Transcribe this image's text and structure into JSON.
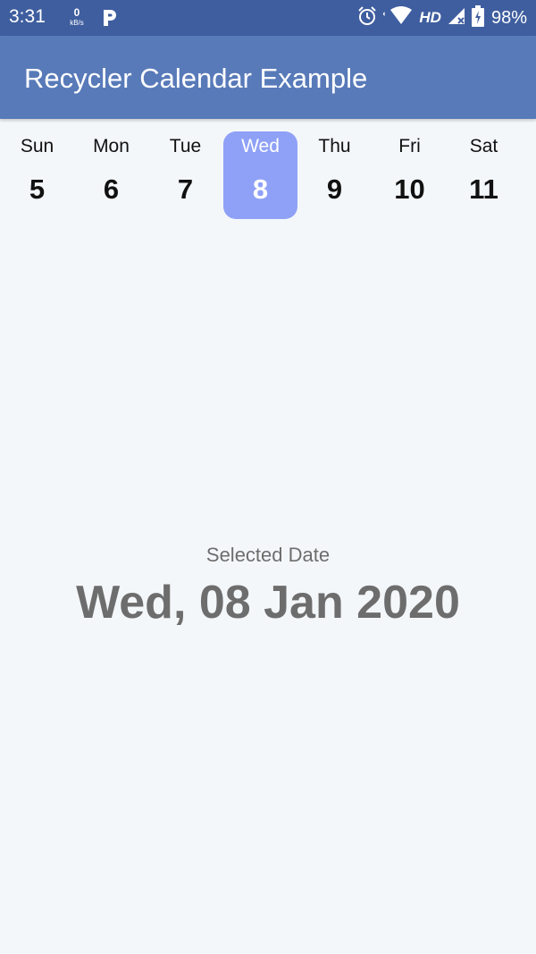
{
  "status_bar": {
    "time": "3:31",
    "net_speed_value": "0",
    "net_speed_unit": "kB/s",
    "hd_label": "HD",
    "battery_percent": "98%",
    "icons": [
      "parking-icon",
      "alarm-icon",
      "wifi-icon",
      "signal-icon",
      "battery-icon"
    ]
  },
  "app_bar": {
    "title": "Recycler Calendar Example",
    "color": "#587ab9"
  },
  "week": {
    "selected_index": 3,
    "selected_color": "#8fa1f7",
    "days": [
      {
        "name": "Sun",
        "number": "5"
      },
      {
        "name": "Mon",
        "number": "6"
      },
      {
        "name": "Tue",
        "number": "7"
      },
      {
        "name": "Wed",
        "number": "8"
      },
      {
        "name": "Thu",
        "number": "9"
      },
      {
        "name": "Fri",
        "number": "10"
      },
      {
        "name": "Sat",
        "number": "11"
      }
    ]
  },
  "selection": {
    "label": "Selected Date",
    "date": "Wed, 08 Jan 2020"
  }
}
